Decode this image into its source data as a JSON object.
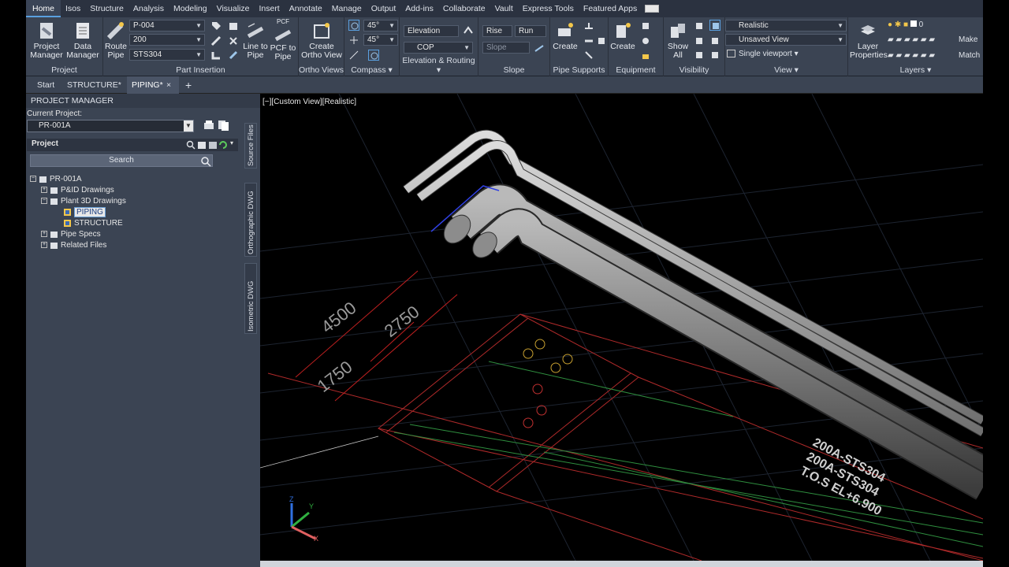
{
  "menu_tabs": [
    "Home",
    "Isos",
    "Structure",
    "Analysis",
    "Modeling",
    "Visualize",
    "Insert",
    "Annotate",
    "Manage",
    "Output",
    "Add-ins",
    "Collaborate",
    "Vault",
    "Express Tools",
    "Featured Apps"
  ],
  "ribbon": {
    "project": {
      "title": "Project",
      "project_manager": "Project Manager",
      "data_manager": "Data Manager"
    },
    "part_insertion": {
      "title": "Part Insertion",
      "route_pipe": "Route Pipe",
      "line_number": "P-004",
      "size": "200",
      "spec": "STS304",
      "line_to_pipe": "Line to Pipe",
      "pcf_to_pipe": "PCF to Pipe",
      "pcf_tag": "PCF"
    },
    "ortho_views": {
      "title": "Ortho Views",
      "create_ortho_view": "Create Ortho View"
    },
    "compass": {
      "title": "Compass",
      "angle1": "45°",
      "angle2": "45°"
    },
    "elevation_routing": {
      "title": "Elevation & Routing",
      "elevation": "Elevation",
      "cop": "COP"
    },
    "slope": {
      "title": "Slope",
      "rise": "Rise",
      "run": "Run",
      "slope": "Slope"
    },
    "pipe_supports": {
      "title": "Pipe Supports",
      "create": "Create"
    },
    "equipment": {
      "title": "Equipment",
      "create": "Create"
    },
    "visibility": {
      "title": "Visibility",
      "show_all": "Show All"
    },
    "view": {
      "title": "View",
      "visual_style": "Realistic",
      "named_view": "Unsaved View",
      "viewport": "Single viewport"
    },
    "layers": {
      "title": "Layers",
      "layer_properties": "Layer Properties",
      "current_layer": "0",
      "make": "Make",
      "match": "Match"
    }
  },
  "doc_tabs": {
    "start": "Start",
    "structure": "STRUCTURE*",
    "piping": "PIPING*",
    "close_glyph": "×",
    "add_glyph": "+"
  },
  "project_manager": {
    "header": "PROJECT MANAGER",
    "current_project_label": "Current Project:",
    "current_project": "PR-001A",
    "project_label": "Project",
    "search_placeholder": "Search",
    "tree": [
      {
        "label": "PR-001A"
      },
      {
        "label": "P&ID Drawings"
      },
      {
        "label": "Plant 3D Drawings"
      },
      {
        "label": "PIPING"
      },
      {
        "label": "STRUCTURE"
      },
      {
        "label": "Pipe Specs"
      },
      {
        "label": "Related Files"
      }
    ],
    "side_tabs": [
      "Source Files",
      "Orthographic DWG",
      "Isometric DWG"
    ]
  },
  "viewport": {
    "label": "[−][Custom View][Realistic]",
    "dimensions": [
      "4500",
      "2750",
      "1750"
    ],
    "annotations": [
      "200A-STS304",
      "200A-STS304",
      "T.O.S EL+6.900"
    ],
    "axis_labels": [
      "Z",
      "Y",
      "X"
    ]
  }
}
